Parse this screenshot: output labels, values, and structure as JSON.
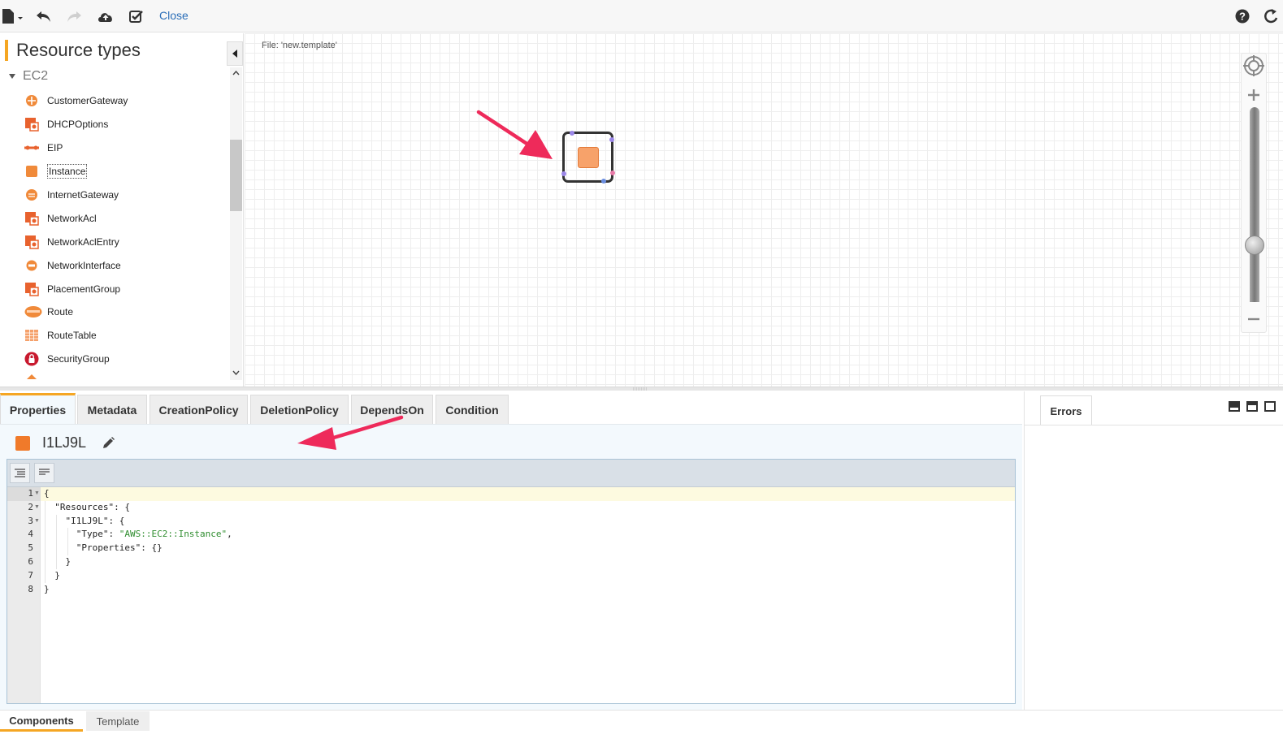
{
  "toolbar": {
    "close_label": "Close"
  },
  "left_panel": {
    "title": "Resource types",
    "group": "EC2",
    "items": [
      {
        "label": "CustomerGateway",
        "icon": "customer-gateway-icon"
      },
      {
        "label": "DHCPOptions",
        "icon": "dhcp-options-icon"
      },
      {
        "label": "EIP",
        "icon": "eip-icon"
      },
      {
        "label": "Instance",
        "icon": "instance-icon",
        "selected": true
      },
      {
        "label": "InternetGateway",
        "icon": "internet-gateway-icon"
      },
      {
        "label": "NetworkAcl",
        "icon": "network-acl-icon"
      },
      {
        "label": "NetworkAclEntry",
        "icon": "network-acl-entry-icon"
      },
      {
        "label": "NetworkInterface",
        "icon": "network-interface-icon"
      },
      {
        "label": "PlacementGroup",
        "icon": "placement-group-icon"
      },
      {
        "label": "Route",
        "icon": "route-icon"
      },
      {
        "label": "RouteTable",
        "icon": "route-table-icon"
      },
      {
        "label": "SecurityGroup",
        "icon": "security-group-icon"
      }
    ]
  },
  "canvas": {
    "file_label": "File: 'new.template'"
  },
  "tabs": [
    {
      "label": "Properties",
      "active": true
    },
    {
      "label": "Metadata"
    },
    {
      "label": "CreationPolicy"
    },
    {
      "label": "DeletionPolicy"
    },
    {
      "label": "DependsOn"
    },
    {
      "label": "Condition"
    }
  ],
  "resource": {
    "name": "I1LJ9L"
  },
  "editor": {
    "lines": [
      {
        "n": "1",
        "fold": true,
        "text": "{"
      },
      {
        "n": "2",
        "fold": true,
        "text": "  \"Resources\": {"
      },
      {
        "n": "3",
        "fold": true,
        "text": "    \"I1LJ9L\": {"
      },
      {
        "n": "4",
        "fold": false,
        "text": "      \"Type\": ",
        "str": "\"AWS::EC2::Instance\"",
        "after": ","
      },
      {
        "n": "5",
        "fold": false,
        "text": "      \"Properties\": {}"
      },
      {
        "n": "6",
        "fold": false,
        "text": "    }"
      },
      {
        "n": "7",
        "fold": false,
        "text": "  }"
      },
      {
        "n": "8",
        "fold": false,
        "text": "}"
      }
    ]
  },
  "errors": {
    "tab_label": "Errors"
  },
  "bottom_tabs": [
    {
      "label": "Components",
      "active": true
    },
    {
      "label": "Template"
    }
  ],
  "colors": {
    "accent": "#f5a623",
    "link": "#2a6eb8",
    "annotation_arrow": "#ee2a5a",
    "instance_orange": "#f7a26a"
  }
}
